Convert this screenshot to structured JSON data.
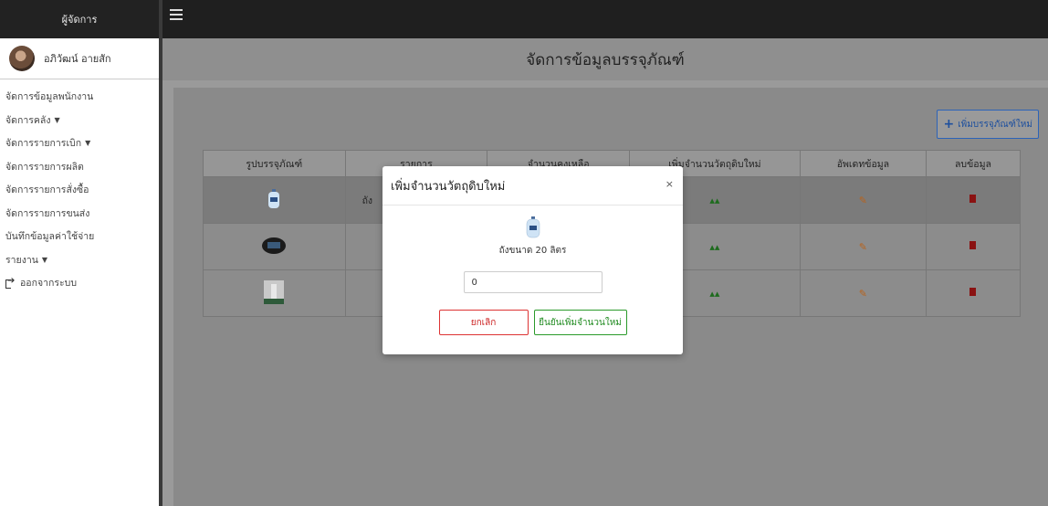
{
  "sidebar": {
    "title": "ผู้จัดการ",
    "user_name": "อภิวัฒน์ อายสัก",
    "items": [
      {
        "label": "จัดการข้อมูลพนักงาน",
        "dropdown": false
      },
      {
        "label": "จัดการคลัง",
        "dropdown": true
      },
      {
        "label": "จัดการรายการเบิก",
        "dropdown": true
      },
      {
        "label": "จัดการรายการผลิต",
        "dropdown": false
      },
      {
        "label": "จัดการรายการสั่งซื้อ",
        "dropdown": false
      },
      {
        "label": "จัดการรายการขนส่ง",
        "dropdown": false
      },
      {
        "label": "บันทึกข้อมูลค่าใช้จ่าย",
        "dropdown": false
      },
      {
        "label": "รายงาน",
        "dropdown": true
      },
      {
        "label": "ออกจากระบบ",
        "dropdown": false
      }
    ],
    "caret": "▼"
  },
  "page": {
    "title": "จัดการข้อมูลบรรจุภัณฑ์",
    "add_button": "เพิ่มบรรจุภัณฑ์ใหม่"
  },
  "table": {
    "headers": [
      "รูปบรรจุภัณฑ์",
      "รายการ",
      "จำนวนคงเหลือ",
      "เพิ่มจำนวนวัตถุดิบใหม่",
      "อัพเดทข้อมูล",
      "ลบข้อมูล"
    ],
    "rows": [
      {
        "item": "ถัง",
        "qty": ""
      },
      {
        "item": "",
        "qty": ""
      },
      {
        "item": "",
        "qty": ""
      }
    ]
  },
  "modal": {
    "title": "เพิ่มจำนวนวัตถุดิบใหม่",
    "close": "×",
    "product_name": "ถังขนาด 20 ลิตร",
    "input_value": "0",
    "cancel": "ยกเลิก",
    "confirm": "ยืนยันเพิ่มจำนวนใหม่"
  },
  "colors": {
    "topbar": "#1f1f1f",
    "primary": "#2c63b8",
    "danger": "#d33333",
    "success": "#2a9a2a",
    "edit": "#b8631c"
  }
}
